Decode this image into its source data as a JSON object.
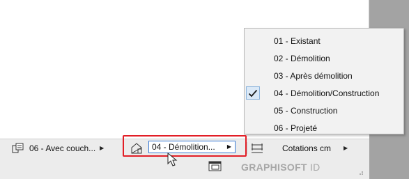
{
  "menu": {
    "items": [
      {
        "label": "01 - Existant",
        "checked": false
      },
      {
        "label": "02 - Démolition",
        "checked": false
      },
      {
        "label": "03 - Après démolition",
        "checked": false
      },
      {
        "label": "04 - Démolition/Construction",
        "checked": true
      },
      {
        "label": "05 - Construction",
        "checked": false
      },
      {
        "label": "06 - Projeté",
        "checked": false
      }
    ]
  },
  "toolbar": {
    "layer_combo": {
      "label": "06 - Avec couch...",
      "icon": "layer-combination-icon"
    },
    "renovation_filter": {
      "label": "04 - Démolition...",
      "icon": "renovation-house-icon"
    },
    "dimension_standard": {
      "label": "Cotations cm",
      "icon": "dimension-icon"
    }
  },
  "status": {
    "brand": "GRAPHISOFT",
    "brand_suffix": "ID"
  },
  "colors": {
    "highlight_red": "#e21e26",
    "active_blue": "#3a7bd5",
    "brand_gray": "#a7a7a7"
  }
}
